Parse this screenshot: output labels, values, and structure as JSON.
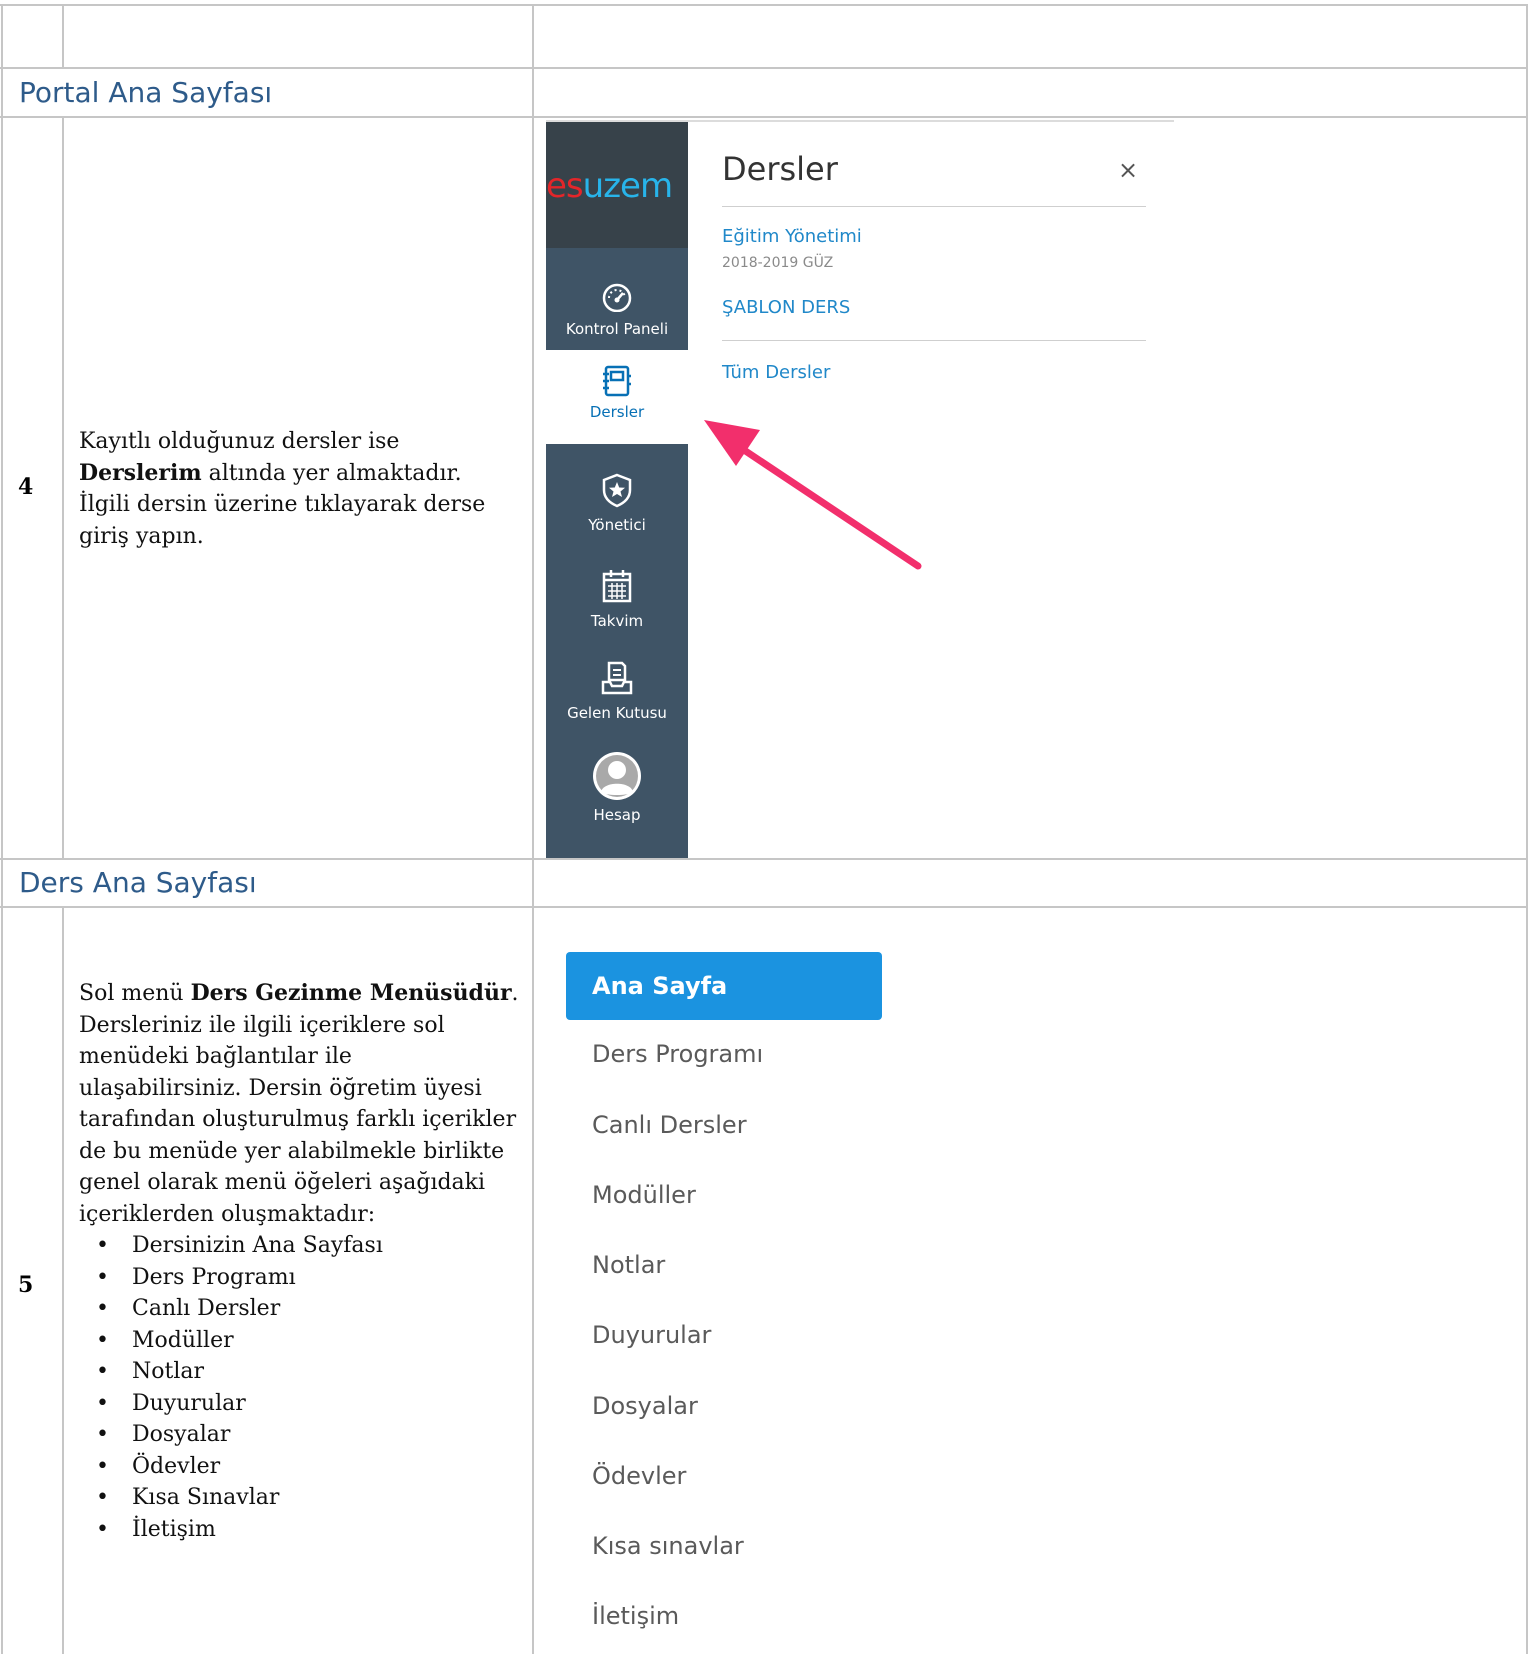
{
  "sections": {
    "portal": {
      "title": "Portal Ana Sayfası"
    },
    "course": {
      "title": "Ders Ana Sayfası"
    }
  },
  "row4": {
    "number": "4",
    "text_part1": "Kayıtlı olduğunuz dersler ise ",
    "text_bold": "Derslerim",
    "text_part2": " altında yer almaktadır. İlgili dersin üzerine tıklayarak derse giriş yapın."
  },
  "portal_screenshot": {
    "logo_part1": "es",
    "logo_part2": "uzem",
    "nav": [
      {
        "label": "Kontrol Paneli",
        "icon": "dashboard-icon"
      },
      {
        "label": "Dersler",
        "icon": "courses-icon",
        "active": true
      },
      {
        "label": "Yönetici",
        "icon": "admin-shield-icon"
      },
      {
        "label": "Takvim",
        "icon": "calendar-icon"
      },
      {
        "label": "Gelen Kutusu",
        "icon": "inbox-icon"
      },
      {
        "label": "Hesap",
        "icon": "account-avatar-icon"
      }
    ],
    "tray": {
      "title": "Dersler",
      "close": "×",
      "course_name": "Eğitim Yönetimi",
      "course_term": "2018-2019 GÜZ",
      "course2_name": "ŞABLON DERS",
      "all_courses": "Tüm Dersler"
    },
    "arrow_color": "#f22f6c"
  },
  "row5": {
    "number": "5",
    "text_part1": "Sol menü ",
    "text_bold": "Ders Gezinme Menüsüdür",
    "text_part2": ". Dersleriniz ile ilgili içeriklere sol menüdeki bağlantılar ile ulaşabilirsiniz. Dersin öğretim üyesi tarafından oluşturulmuş farklı içerikler de bu menüde yer alabilmekle birlikte genel olarak menü öğeleri aşağıdaki içeriklerden oluşmaktadır:",
    "bullets": [
      "Dersinizin Ana Sayfası",
      "Ders Programı",
      "Canlı Dersler",
      "Modüller",
      "Notlar",
      "Duyurular",
      "Dosyalar",
      "Ödevler",
      "Kısa Sınavlar",
      "İletişim"
    ]
  },
  "course_screenshot": {
    "menu": [
      "Ana Sayfa",
      "Ders Programı",
      "Canlı Dersler",
      "Modüller",
      "Notlar",
      "Duyurular",
      "Dosyalar",
      "Ödevler",
      "Kısa sınavlar",
      "İletişim"
    ],
    "active_color": "#1b93e0"
  }
}
